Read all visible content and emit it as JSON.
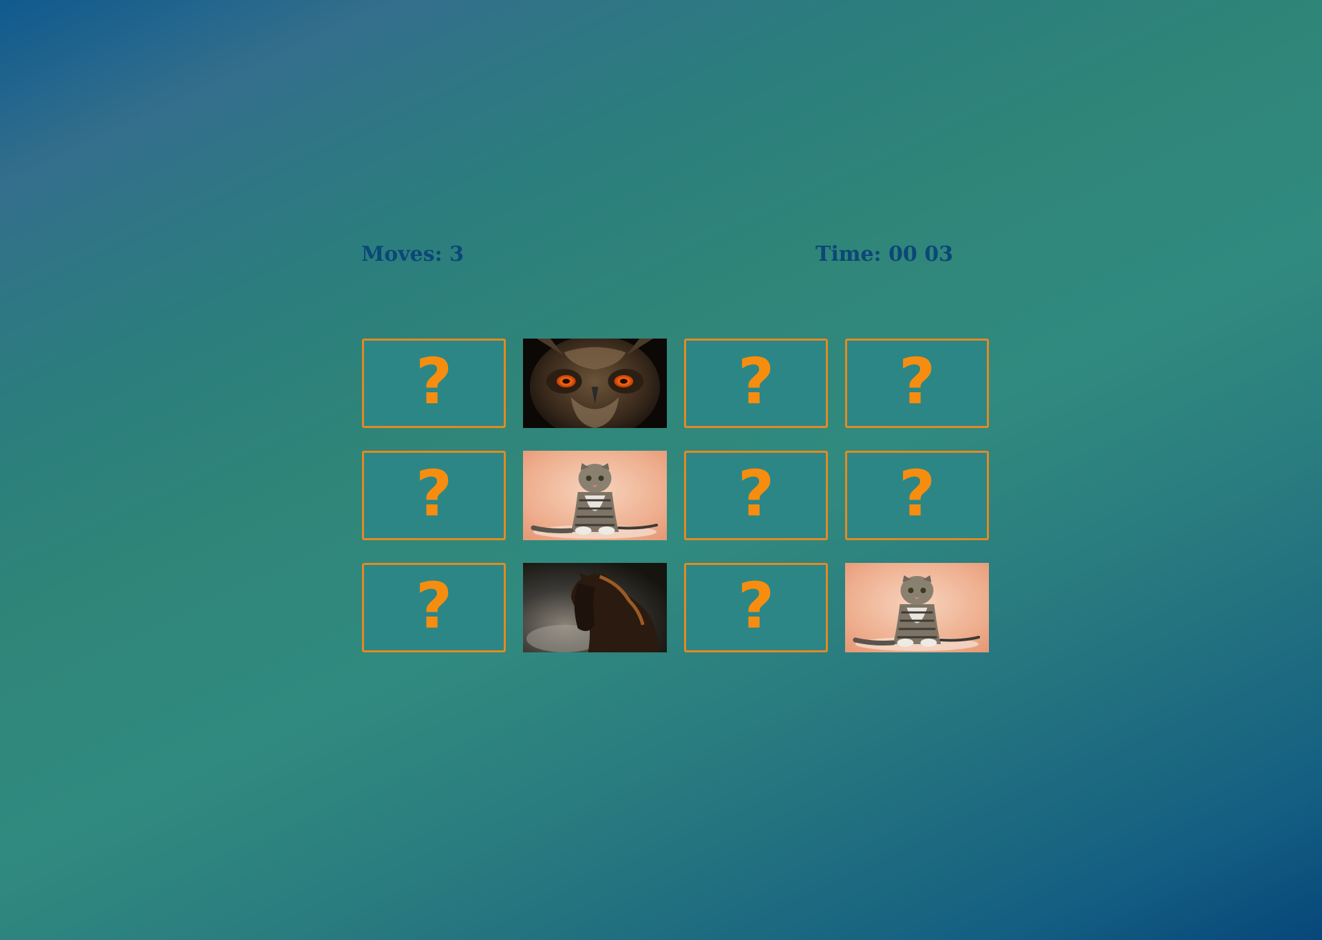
{
  "stats": {
    "moves_label": "Moves: 3",
    "time_label": "Time: 00 03"
  },
  "colors": {
    "card_border": "#e48a21",
    "card_face": "#2c8686",
    "question_mark": "#f78d0f",
    "stat_text": "#0b4777"
  },
  "board": {
    "rows": 3,
    "cols": 4,
    "cards": [
      {
        "state": "hidden",
        "symbol": "?"
      },
      {
        "state": "revealed",
        "animal": "owl"
      },
      {
        "state": "hidden",
        "symbol": "?"
      },
      {
        "state": "hidden",
        "symbol": "?"
      },
      {
        "state": "hidden",
        "symbol": "?"
      },
      {
        "state": "revealed",
        "animal": "cat"
      },
      {
        "state": "hidden",
        "symbol": "?"
      },
      {
        "state": "hidden",
        "symbol": "?"
      },
      {
        "state": "hidden",
        "symbol": "?"
      },
      {
        "state": "revealed",
        "animal": "horse"
      },
      {
        "state": "hidden",
        "symbol": "?"
      },
      {
        "state": "revealed",
        "animal": "cat"
      }
    ]
  }
}
